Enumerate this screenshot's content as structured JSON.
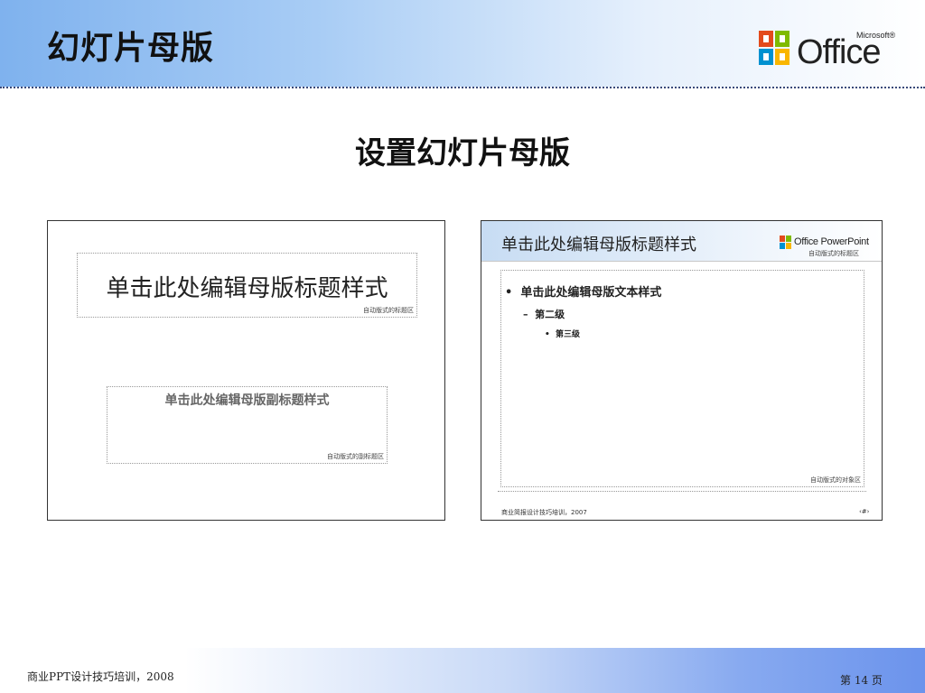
{
  "header": {
    "title": "幻灯片母版",
    "logo": {
      "word": "Office",
      "brand": "Microsoft®",
      "colors": [
        "#e34a1c",
        "#7fba00",
        "#0091d0",
        "#f9b600"
      ]
    }
  },
  "main": {
    "subtitle": "设置幻灯片母版",
    "title_slide": {
      "title_placeholder": "单击此处编辑母版标题样式",
      "title_area_label": "自动版式的标题区",
      "subtitle_placeholder": "单击此处编辑母版副标题样式",
      "subtitle_area_label": "自动版式的副标题区"
    },
    "content_slide": {
      "title_placeholder": "单击此处编辑母版标题样式",
      "logo_text": "Office PowerPoint",
      "title_area_label": "自动版式的标题区",
      "level1": "单击此处编辑母版文本样式",
      "level2": "第二级",
      "level3": "第三级",
      "object_area_label": "自动版式的对象区",
      "footer": "商业简报设计技巧培训，2007",
      "number": "‹#›",
      "bullets": {
        "l1": "•",
        "l2": "–",
        "l3": "•"
      }
    }
  },
  "footer": {
    "text": "商业PPT设计技巧培训，2008",
    "page": "第 14 页"
  }
}
